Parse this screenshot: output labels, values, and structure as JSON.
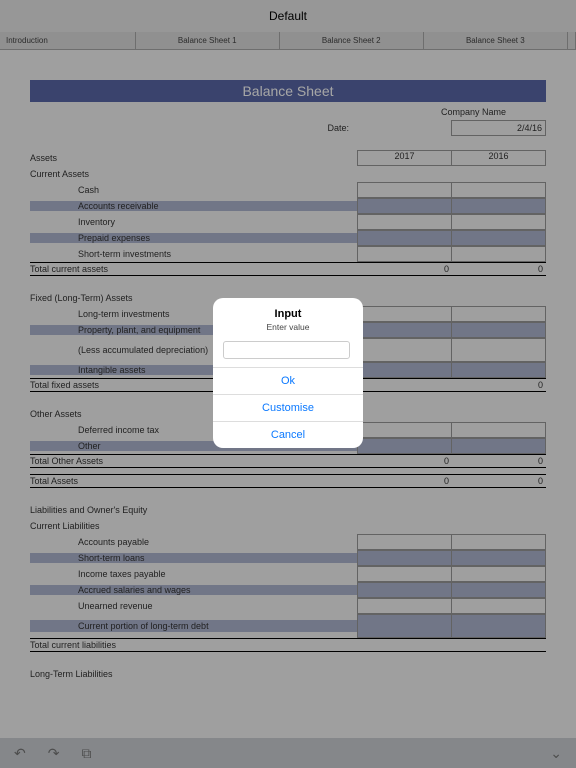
{
  "header": {
    "title": "Default"
  },
  "tabs": [
    "Introduction",
    "Balance Sheet 1",
    "Balance Sheet 2",
    "Balance Sheet 3"
  ],
  "sheet": {
    "title": "Balance Sheet",
    "company_label": "Company Name",
    "date_label": "Date:",
    "date_value": "2/4/16",
    "col1": "2017",
    "col2": "2016",
    "s_assets": "Assets",
    "s_current_assets": "Current Assets",
    "r_cash": "Cash",
    "r_ar": "Accounts receivable",
    "r_inv": "Inventory",
    "r_prepaid": "Prepaid expenses",
    "r_sti": "Short-term investments",
    "t_tca": "Total current assets",
    "z": "0",
    "s_fixed": "Fixed (Long-Term) Assets",
    "r_lti": "Long-term investments",
    "r_ppe": "Property, plant, and equipment",
    "r_dep": "(Less accumulated depreciation)",
    "r_int": "Intangible assets",
    "t_tfa": "Total fixed assets",
    "s_other": "Other Assets",
    "r_dit": "Deferred income tax",
    "r_other": "Other",
    "t_toa": "Total Other Assets",
    "t_ta": "Total Assets",
    "s_loe": "Liabilities and Owner's Equity",
    "s_cl": "Current Liabilities",
    "r_ap": "Accounts payable",
    "r_stl": "Short-term loans",
    "r_itp": "Income taxes payable",
    "r_asw": "Accrued salaries and wages",
    "r_ur": "Unearned revenue",
    "r_cpltd": "Current portion of long-term debt",
    "t_tcl": "Total current liabilities",
    "s_ltl": "Long-Term Liabilities"
  },
  "dialog": {
    "title": "Input",
    "subtitle": "Enter value",
    "ok": "Ok",
    "customise": "Customise",
    "cancel": "Cancel"
  },
  "chart_data": {
    "type": "table",
    "columns": [
      "2017",
      "2016"
    ],
    "sections": [
      {
        "name": "Current Assets",
        "rows": [
          "Cash",
          "Accounts receivable",
          "Inventory",
          "Prepaid expenses",
          "Short-term investments"
        ],
        "total": "Total current assets",
        "values": [
          0,
          0
        ]
      },
      {
        "name": "Fixed (Long-Term) Assets",
        "rows": [
          "Long-term investments",
          "Property, plant, and equipment",
          "(Less accumulated depreciation)",
          "Intangible assets"
        ],
        "total": "Total fixed assets",
        "values": [
          null,
          0
        ]
      },
      {
        "name": "Other Assets",
        "rows": [
          "Deferred income tax",
          "Other"
        ],
        "total": "Total Other Assets",
        "values": [
          0,
          0
        ]
      },
      {
        "name": "Total Assets",
        "values": [
          0,
          0
        ]
      },
      {
        "name": "Current Liabilities",
        "rows": [
          "Accounts payable",
          "Short-term loans",
          "Income taxes payable",
          "Accrued salaries and wages",
          "Unearned revenue",
          "Current portion of long-term debt"
        ],
        "total": "Total current liabilities"
      }
    ]
  }
}
